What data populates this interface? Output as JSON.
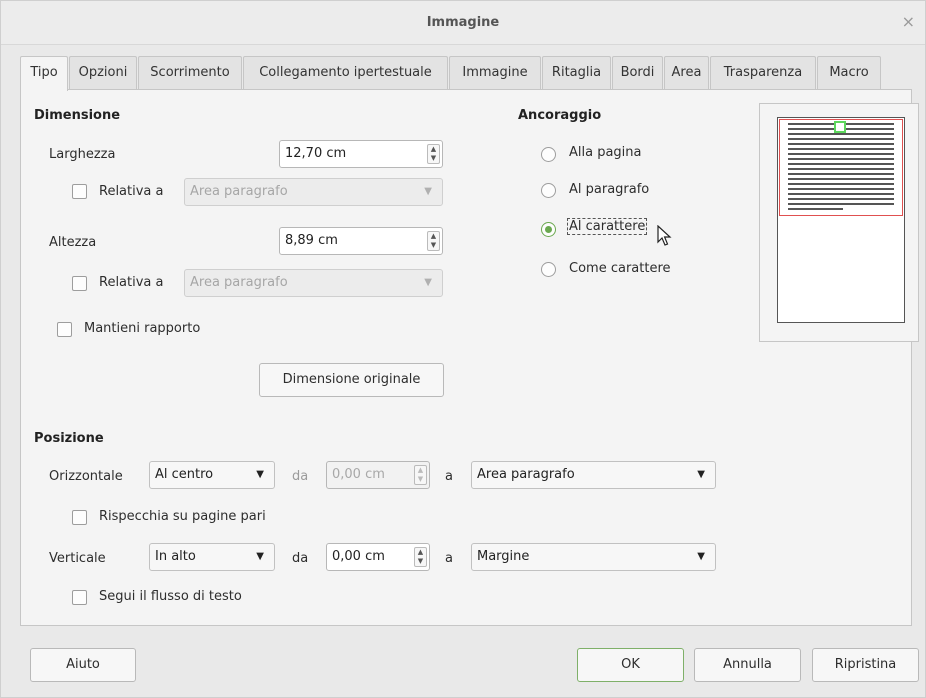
{
  "window": {
    "title": "Immagine",
    "close_glyph": "×"
  },
  "tabs": [
    {
      "label": "Tipo",
      "active": true
    },
    {
      "label": "Opzioni"
    },
    {
      "label": "Scorrimento"
    },
    {
      "label": "Collegamento ipertestuale"
    },
    {
      "label": "Immagine"
    },
    {
      "label": "Ritaglia"
    },
    {
      "label": "Bordi"
    },
    {
      "label": "Area"
    },
    {
      "label": "Trasparenza"
    },
    {
      "label": "Macro"
    }
  ],
  "dimensione": {
    "heading": "Dimensione",
    "larghezza_label": "Larghezza",
    "larghezza_value": "12,70 cm",
    "relativa_label_1": "Relativa a",
    "relativa_combo_1": "Area paragrafo",
    "altezza_label": "Altezza",
    "altezza_value": "8,89 cm",
    "relativa_label_2": "Relativa a",
    "relativa_combo_2": "Area paragrafo",
    "mantieni_label": "Mantieni rapporto",
    "original_button": "Dimensione originale"
  },
  "ancoraggio": {
    "heading": "Ancoraggio",
    "options": [
      "Alla pagina",
      "Al paragrafo",
      "Al carattere",
      "Come carattere"
    ],
    "selected": "Al carattere"
  },
  "posizione": {
    "heading": "Posizione",
    "orizzontale_label": "Orizzontale",
    "orizzontale_value": "Al centro",
    "da_label_1": "da",
    "da_value_1": "0,00 cm",
    "a_label_1": "a",
    "a_value_1": "Area paragrafo",
    "rispecchia_label": "Rispecchia su pagine pari",
    "verticale_label": "Verticale",
    "verticale_value": "In alto",
    "da_label_2": "da",
    "da_value_2": "0,00 cm",
    "a_label_2": "a",
    "a_value_2": "Margine",
    "segui_label": "Segui il flusso di testo"
  },
  "footer": {
    "help": "Aiuto",
    "ok": "OK",
    "cancel": "Annulla",
    "reset": "Ripristina"
  }
}
